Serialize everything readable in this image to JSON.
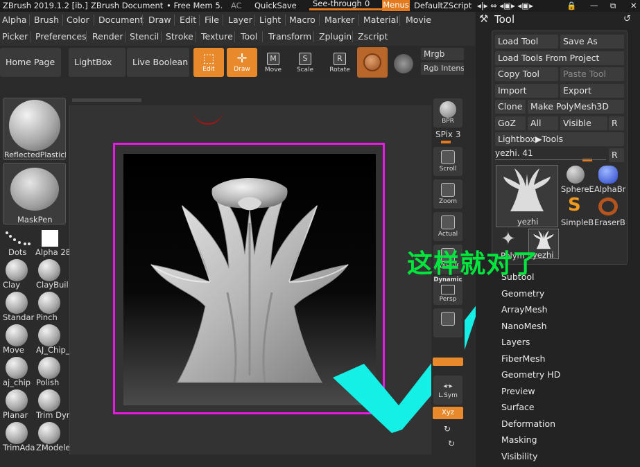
{
  "titlebar": {
    "app": "ZBrush 2019.1.2 [ib.]",
    "document": "ZBrush Document",
    "free_mem": "• Free Mem 5.",
    "ac": "AC",
    "quicksave": "QuickSave",
    "see_through_label": "See-through",
    "see_through_value": "0",
    "menus": "Menus",
    "script": "DefaultZScript"
  },
  "menu_row1": [
    "Alpha",
    "Brush",
    "Color",
    "Document",
    "Draw",
    "Edit",
    "File",
    "Layer",
    "Light",
    "Macro",
    "Marker",
    "Material",
    "Movie"
  ],
  "menu_row2": [
    "Picker",
    "Preferences",
    "Render",
    "Stencil",
    "Stroke",
    "Texture",
    "Tool",
    "Transform",
    "Zplugin",
    "Zscript"
  ],
  "toolbar": {
    "home_page": "Home Page",
    "lightbox": "LightBox",
    "live_boolean": "Live Boolean",
    "edit": "Edit",
    "draw": "Draw",
    "move": "Move",
    "scale": "Scale",
    "rotate": "Rotate",
    "mrgb": "Mrgb",
    "rgb_intensity": "Rgb Intens"
  },
  "left_shelf": {
    "material": "ReflectedPlasticB",
    "stroke_brush": "MaskPen",
    "stroke": "Dots",
    "alpha": "Alpha 28",
    "brushes": [
      "Clay",
      "ClayBuil",
      "Standar",
      "Pinch",
      "Move",
      "AJ_Chip_",
      "aj_chip",
      "Polish",
      "Planar",
      "Trim Dyn",
      "TrimAda",
      "ZModele"
    ]
  },
  "right_strip": {
    "bpr": "BPR",
    "spix": "SPix 3",
    "scroll": "Scroll",
    "zoom": "Zoom",
    "actual": "Actual",
    "aahalf": "AAHalf",
    "dynamic": "Dynamic",
    "persp": "Persp",
    "lsym": "L.Sym",
    "xyz": "Xyz"
  },
  "tool_panel": {
    "title": "Tool",
    "load_tool": "Load Tool",
    "save_as": "Save As",
    "load_from_project": "Load Tools From Project",
    "copy_tool": "Copy Tool",
    "paste_tool": "Paste Tool",
    "import": "Import",
    "export": "Export",
    "clone": "Clone",
    "make_polymesh": "Make PolyMesh3D",
    "goz": "GoZ",
    "all": "All",
    "visible": "Visible",
    "r": "R",
    "lightbox_tools": "Lightbox▶Tools",
    "current_tool": "yezhi. 41",
    "current_tool_label": "yezhi",
    "tools": [
      "SphereE",
      "AlphaBr",
      "SimpleB",
      "EraserB"
    ],
    "small_tools": [
      "Polym",
      "yezhi"
    ],
    "subpalettes": [
      "Subtool",
      "Geometry",
      "ArrayMesh",
      "NanoMesh",
      "Layers",
      "FiberMesh",
      "Geometry HD",
      "Preview",
      "Surface",
      "Deformation",
      "Masking",
      "Visibility"
    ]
  },
  "overlay": {
    "caption": "这样就对了"
  },
  "colors": {
    "accent_orange": "#e8892b",
    "selection_magenta": "#e81ae3",
    "checkmark_cyan": "#14f0e6",
    "caption_green": "#00e63d"
  }
}
